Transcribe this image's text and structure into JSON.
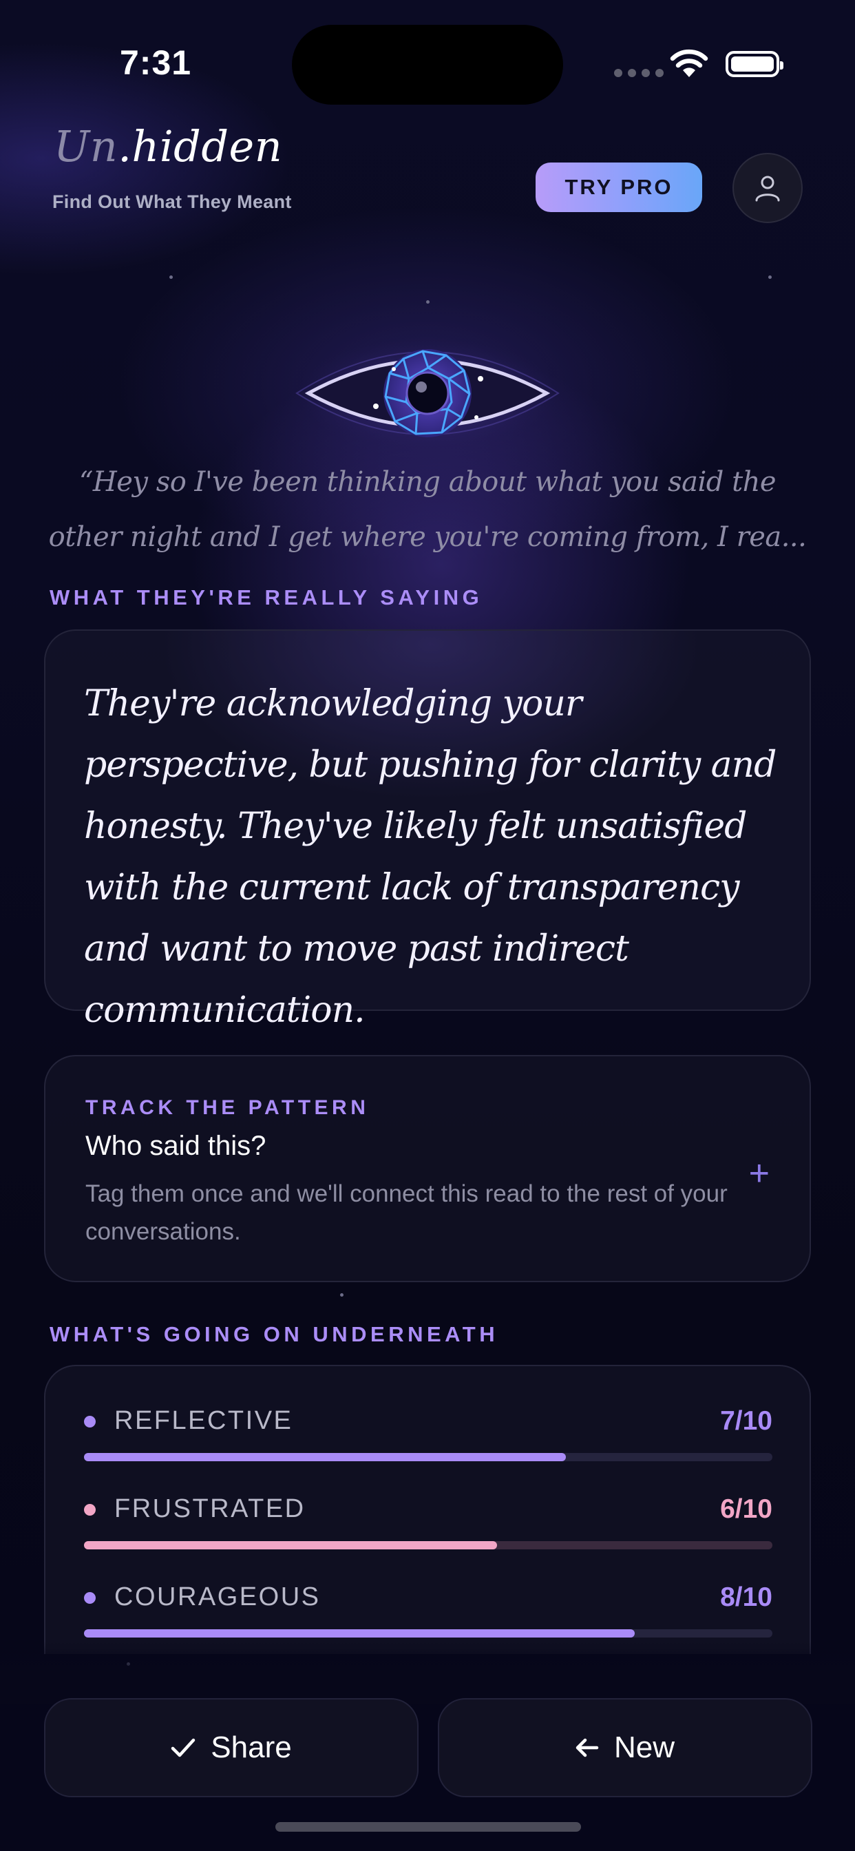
{
  "status_bar": {
    "time": "7:31"
  },
  "header": {
    "logo_dim": "Un",
    "logo_bright": ".hidden",
    "tagline": "Find Out What They Meant",
    "try_pro_label": "TRY PRO",
    "profile_icon": "person-icon"
  },
  "quote": "“Hey so I've been thinking about what you said the other night and I get where you're coming from, I rea...",
  "translation": {
    "section_label": "WHAT THEY'RE REALLY SAYING",
    "text": "They're acknowledging your perspective, but pushing for clarity and honesty. They've likely felt unsatisfied with the current lack of transparency and want to move past indirect communication."
  },
  "track": {
    "label": "TRACK THE PATTERN",
    "title": "Who said this?",
    "description": "Tag them once and we'll connect this read to the rest of your conversations.",
    "add_symbol": "+"
  },
  "underneath": {
    "section_label": "WHAT'S GOING ON UNDERNEATH",
    "emotions": [
      {
        "name": "REFLECTIVE",
        "score_text": "7/10",
        "score": 0.7,
        "color": "#a98bf7",
        "track_color": "#25243e"
      },
      {
        "name": "FRUSTRATED",
        "score_text": "6/10",
        "score": 0.6,
        "color": "#f2a6c6",
        "track_color": "#3a2a3e"
      },
      {
        "name": "COURAGEOUS",
        "score_text": "8/10",
        "score": 0.8,
        "color": "#a98bf7",
        "track_color": "#25243e"
      }
    ]
  },
  "actions": {
    "share_label": "Share",
    "share_icon": "checkmark-icon",
    "new_label": "New",
    "new_icon": "arrow-left-icon"
  }
}
